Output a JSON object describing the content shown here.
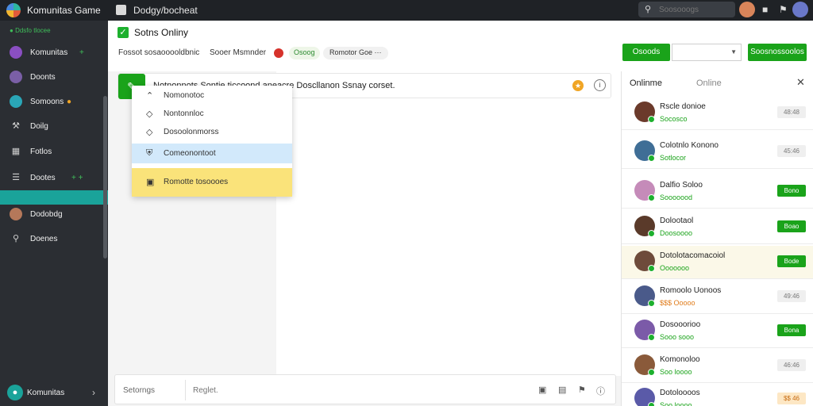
{
  "topbar": {
    "app_title": "Komunitas Game",
    "doc_title": "Dodgy/bocheat",
    "search_placeholder": "Soosooogs"
  },
  "sidebar": {
    "status": "Ddsfo tlocee",
    "items": [
      {
        "label": "Komunitas",
        "badge": "+",
        "icon_color": "#8a4fc2",
        "icon": "avatar-icon"
      },
      {
        "label": "Doonts",
        "badge": "",
        "icon_color": "#7a5fa6",
        "icon": "avatar-icon"
      },
      {
        "label": "Somoons",
        "badge": "",
        "icon_color": "#2aa6b7",
        "icon": "user-icon"
      },
      {
        "label": "Doilg",
        "badge": "",
        "icon_color": "#999",
        "icon": "wrench-icon"
      },
      {
        "label": "Fotlos",
        "badge": "",
        "icon_color": "#999",
        "icon": "grid-icon"
      },
      {
        "label": "Dootes",
        "badge": "+ +",
        "icon_color": "#999",
        "icon": "list-icon"
      },
      {
        "label": "Dodobdg",
        "badge": "",
        "icon_color": "#b5785a",
        "icon": "avatar-icon"
      },
      {
        "label": "Doenes",
        "badge": "",
        "icon_color": "#999",
        "icon": "search-icon"
      }
    ],
    "footer_label": "Komunitas"
  },
  "main": {
    "title": "Sotns Onliny",
    "subbar_text": "Fossot sosaooooldbnic",
    "subbar_name": "Sooer Msmnder",
    "pill_label": "Osoog",
    "pill2_label": "Romotor Goe ···",
    "message_text": "Notnonnots Sontie ticcoond aneacre Doscllanon Ssnay corset.",
    "dropdown": [
      {
        "label": "Nomonotoc",
        "icon": "chevron-up-icon"
      },
      {
        "label": "Nontonnloc",
        "icon": "diamond-icon"
      },
      {
        "label": "Dosoolonmorss",
        "icon": "diamond-icon"
      },
      {
        "label": "Comeonontoot",
        "icon": "shield-icon"
      },
      {
        "label": "Romotte tosoooes",
        "icon": "box-icon"
      }
    ],
    "composer_left": "Setorngs",
    "composer_placeholder": "Reglet."
  },
  "top_controls": {
    "btn1": "Osoods",
    "btn2": "Soosnossoolos"
  },
  "rpanel": {
    "tab1": "Onlinme",
    "tab2": "Online",
    "contacts": [
      {
        "name": "Rscle donioe",
        "sub": "Socosco",
        "sub_style": "green",
        "tag": "48:48",
        "tag_style": "grey",
        "avatar": "#6b3a2b",
        "highlight": false
      },
      {
        "name": "Colotnlo Konono",
        "sub": "Sotlocor",
        "sub_style": "green",
        "tag": "45:46",
        "tag_style": "grey",
        "avatar": "#3f6e96",
        "highlight": false
      },
      {
        "name": "Dalfio Soloo",
        "sub": "Sooooood",
        "sub_style": "green",
        "tag": "Bono",
        "tag_style": "green",
        "avatar": "#c58bb9",
        "highlight": false
      },
      {
        "name": "Dolootaol",
        "sub": "Doosoooo",
        "sub_style": "green",
        "tag": "Boao",
        "tag_style": "green",
        "avatar": "#5a3a2a",
        "highlight": false
      },
      {
        "name": "Dotolotacomacoiol",
        "sub": "Ooooooo",
        "sub_style": "green",
        "tag": "Bode",
        "tag_style": "green",
        "avatar": "#6e4b3b",
        "highlight": true
      },
      {
        "name": "Romoolo Uonoos",
        "sub": "$$$ Ooooo",
        "sub_style": "orange",
        "tag": "49:46",
        "tag_style": "grey",
        "avatar": "#4a5a8a",
        "highlight": false
      },
      {
        "name": "Dosooorioo",
        "sub": "Sooo sooo",
        "sub_style": "green",
        "tag": "Bona",
        "tag_style": "green",
        "avatar": "#7b5aa8",
        "highlight": false
      },
      {
        "name": "Komonoloo",
        "sub": "Soo loooo",
        "sub_style": "green",
        "tag": "46:46",
        "tag_style": "grey",
        "avatar": "#8a5a3a",
        "highlight": false
      },
      {
        "name": "Dotoloooos",
        "sub": "Soo loooo",
        "sub_style": "green",
        "tag": "$$ 46",
        "tag_style": "orange",
        "avatar": "#5a5aa8",
        "highlight": false
      }
    ]
  },
  "colors": {
    "accent_green": "#1aa31a",
    "sidebar_bg": "#2b2e33",
    "topbar_bg": "#1f2226",
    "selection_teal": "#1aa39a"
  }
}
